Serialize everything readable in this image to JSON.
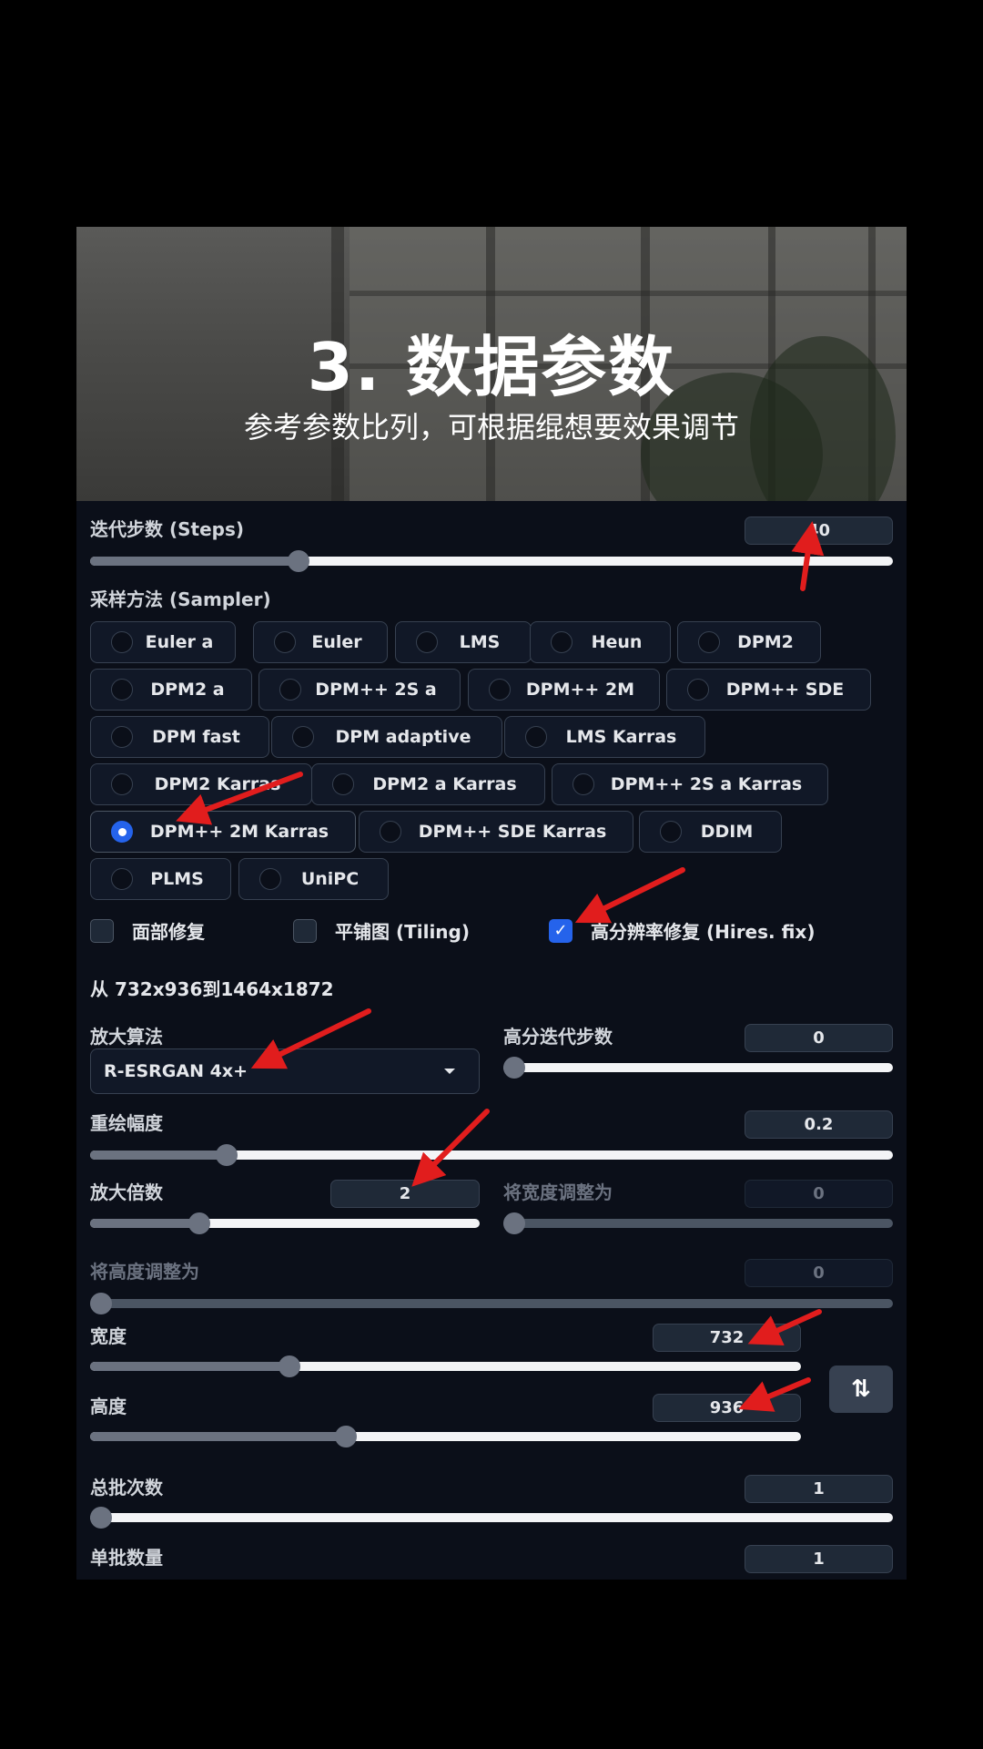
{
  "banner": {
    "title": "3. 数据参数",
    "subtitle": "参考参数比列，可根据绲想要效果调节"
  },
  "steps": {
    "label": "迭代步数 (Steps)",
    "value": "40",
    "level": 0.26
  },
  "sampler": {
    "label": "采样方法 (Sampler)",
    "options": [
      "Euler a",
      "Euler",
      "LMS",
      "Heun",
      "DPM2",
      "DPM2 a",
      "DPM++ 2S a",
      "DPM++ 2M",
      "DPM++ SDE",
      "DPM fast",
      "DPM adaptive",
      "LMS Karras",
      "DPM2 Karras",
      "DPM2 a Karras",
      "DPM++ 2S a Karras",
      "DPM++ 2M Karras",
      "DPM++ SDE Karras",
      "DDIM",
      "PLMS",
      "UniPC"
    ],
    "selected": "DPM++ 2M Karras"
  },
  "checkboxes": {
    "face_restore": "面部修复",
    "tiling": "平铺图 (Tiling)",
    "hires_fix": "高分辨率修复 (Hires. fix)",
    "hires_fix_checked": true
  },
  "hires": {
    "info": "从 732x936到1464x1872",
    "upscaler_label": "放大算法",
    "upscaler_value": "R-ESRGAN 4x+",
    "hires_steps_label": "高分迭代步数",
    "hires_steps_value": "0",
    "denoise_label": "重绘幅度",
    "denoise_value": "0.2",
    "denoise_level": 0.2,
    "scale_label": "放大倍数",
    "scale_value": "2",
    "scale_level": 0.34,
    "resize_w_label": "将宽度调整为",
    "resize_w_value": "0",
    "resize_h_label": "将高度调整为",
    "resize_h_value": "0"
  },
  "size": {
    "width_label": "宽度",
    "width_value": "732",
    "width_level": 0.34,
    "height_label": "高度",
    "height_value": "936",
    "height_level": 0.44,
    "swap_icon": "⇅"
  },
  "batch": {
    "count_label": "总批次数",
    "count_value": "1",
    "size_label": "单批数量",
    "size_value": "1"
  }
}
